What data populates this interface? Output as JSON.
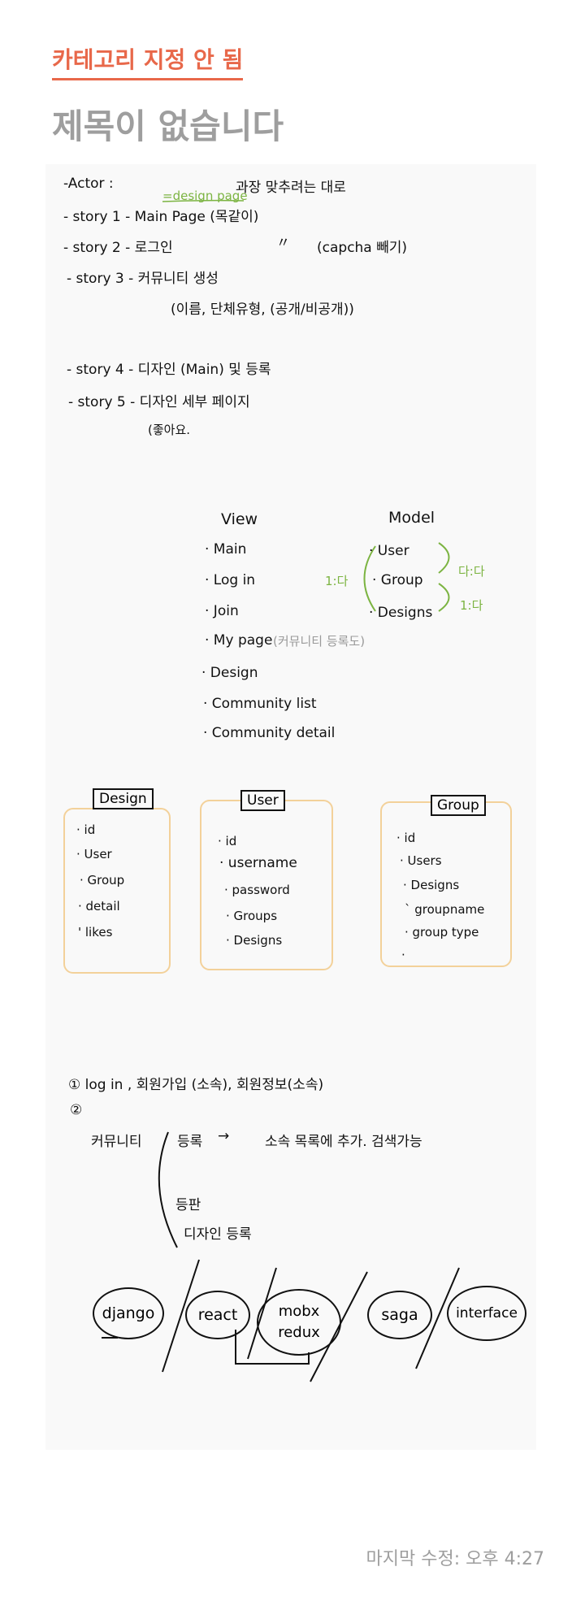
{
  "header": {
    "category": "카테고리 지정 안 됨",
    "title": "제목이 없습니다"
  },
  "stories": {
    "actor": "-Actor :",
    "actor_note": "과장 맞추려는 대로",
    "design_page_note": "=design page",
    "story1": "- story 1 - Main Page (목같이)",
    "story2": "- story 2 - 로그인",
    "story2_ditto": "〃",
    "story2_note": "(capcha 빼기)",
    "story3": "- story 3 - 커뮤니티 생성",
    "story3_detail": "(이름, 단체유형, (공개/비공개))",
    "story4": "- story 4 - 디자인 (Main) 및 등록",
    "story5": "- story 5 - 디자인 세부 페이지",
    "story5_detail": "(좋아요."
  },
  "view": {
    "heading": "View",
    "items": [
      "· Main",
      "· Log in",
      "· Join",
      "· My page",
      "· Design",
      "· Community list",
      "· Community detail"
    ],
    "mypage_note": "(커뮤니티 등록도)"
  },
  "model": {
    "heading": "Model",
    "items": [
      "· User",
      "· Group",
      "· Designs"
    ],
    "rel_left": "1:다",
    "rel_top": "다:다",
    "rel_bottom": "1:다"
  },
  "tables": {
    "design": {
      "title": "Design",
      "fields": [
        "· id",
        "· User",
        "· Group",
        "· detail",
        "' likes"
      ]
    },
    "user": {
      "title": "User",
      "fields": [
        "· id",
        "· username",
        "· password",
        "· Groups",
        "· Designs"
      ]
    },
    "group": {
      "title": "Group",
      "fields": [
        "· id",
        "· Users",
        "· Designs",
        "` groupname",
        "· group type",
        "·"
      ]
    }
  },
  "notes": {
    "line1": "① log in , 회원가입 (소속), 회원정보(소속)",
    "line2": "②",
    "community": "커뮤니티",
    "register": "등록",
    "arrow": "→",
    "register_note": "소속 목록에 추가. 검색가능",
    "board": "등판",
    "design_register": "디자인 등록"
  },
  "stack": {
    "items": [
      "django",
      "react",
      "mobx",
      "redux",
      "saga",
      "interface"
    ]
  },
  "footer": {
    "modified": "마지막 수정: 오후 4:27"
  }
}
